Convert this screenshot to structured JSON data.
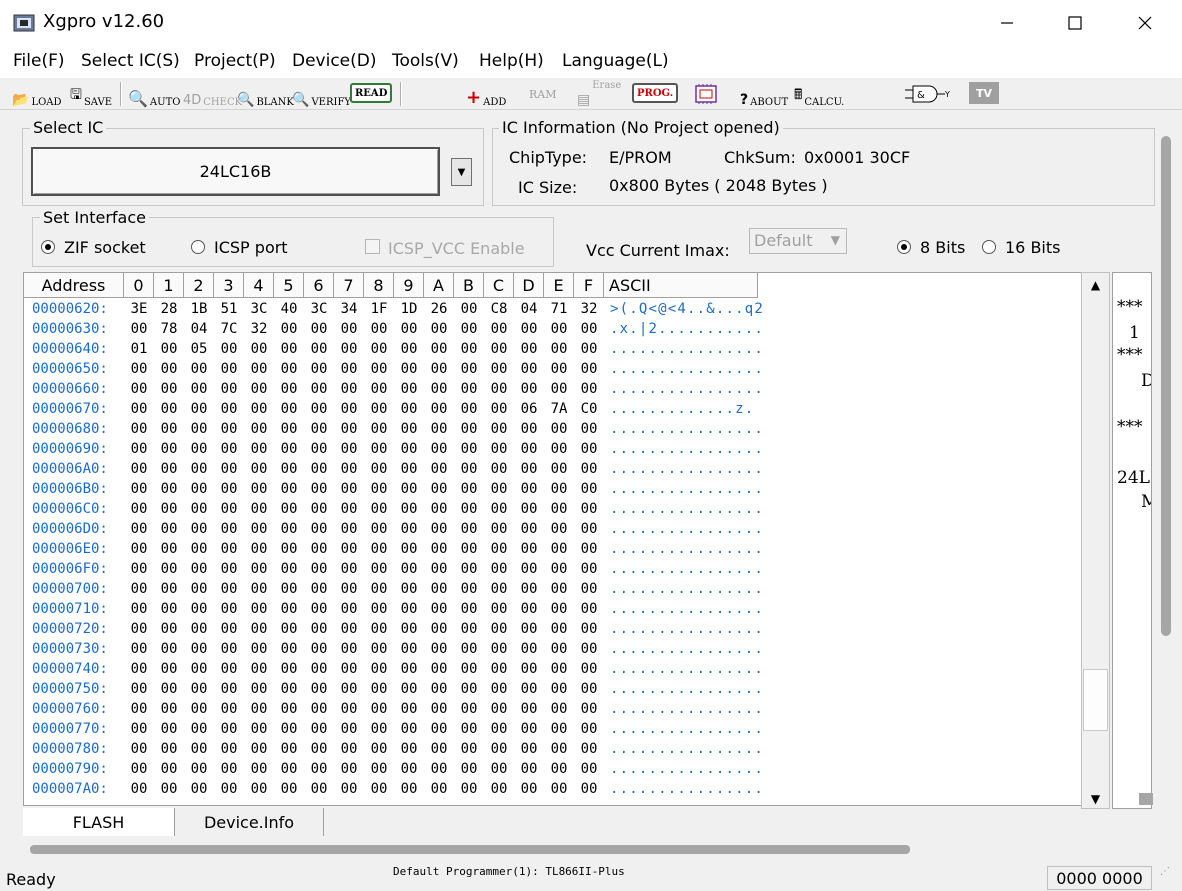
{
  "window": {
    "title": "Xgpro v12.60",
    "min_icon": "minimize-icon",
    "max_icon": "maximize-icon",
    "close_icon": "close-icon"
  },
  "menu": [
    "File(F)",
    "Select IC(S)",
    "Project(P)",
    "Device(D)",
    "Tools(V)",
    "Help(H)",
    "Language(L)"
  ],
  "toolbar": {
    "load": "LOAD",
    "save": "SAVE",
    "auto": "AUTO",
    "check": "CHECK",
    "blank": "BLANK",
    "verify": "VERIFY",
    "read": "READ",
    "add": "ADD",
    "ram": "RAM",
    "erase": "Erase",
    "prog": "PROG.",
    "about": "ABOUT",
    "calcu": "CALCU.",
    "logic": "&",
    "tv": "TV"
  },
  "select_ic": {
    "label": "Select IC",
    "value": "24LC16B"
  },
  "ic_info": {
    "label": "IC Information (No Project opened)",
    "chiptype_label": "ChipType:",
    "chiptype_value": "E/PROM",
    "chksum_label": "ChkSum:",
    "chksum_value": "0x0001 30CF",
    "size_label": "IC Size:",
    "size_value": "0x800 Bytes ( 2048 Bytes )"
  },
  "interface": {
    "label": "Set Interface",
    "zif": "ZIF socket",
    "icsp": "ICSP port",
    "icsp_vcc": "ICSP_VCC Enable",
    "vcc_label": "Vcc Current Imax:",
    "vcc_value": "Default",
    "bits8": "8 Bits",
    "bits16": "16 Bits"
  },
  "hex": {
    "headers": [
      "Address",
      "0",
      "1",
      "2",
      "3",
      "4",
      "5",
      "6",
      "7",
      "8",
      "9",
      "A",
      "B",
      "C",
      "D",
      "E",
      "F",
      "ASCII"
    ],
    "rows": [
      {
        "addr": "00000620:",
        "bytes": [
          "3E",
          "28",
          "1B",
          "51",
          "3C",
          "40",
          "3C",
          "34",
          "1F",
          "1D",
          "26",
          "00",
          "C8",
          "04",
          "71",
          "32"
        ],
        "ascii": ">(.Q<@<4..&...q2"
      },
      {
        "addr": "00000630:",
        "bytes": [
          "00",
          "78",
          "04",
          "7C",
          "32",
          "00",
          "00",
          "00",
          "00",
          "00",
          "00",
          "00",
          "00",
          "00",
          "00",
          "00"
        ],
        "ascii": ".x.|2..........."
      },
      {
        "addr": "00000640:",
        "bytes": [
          "01",
          "00",
          "05",
          "00",
          "00",
          "00",
          "00",
          "00",
          "00",
          "00",
          "00",
          "00",
          "00",
          "00",
          "00",
          "00"
        ],
        "ascii": "................"
      },
      {
        "addr": "00000650:",
        "bytes": [
          "00",
          "00",
          "00",
          "00",
          "00",
          "00",
          "00",
          "00",
          "00",
          "00",
          "00",
          "00",
          "00",
          "00",
          "00",
          "00"
        ],
        "ascii": "................"
      },
      {
        "addr": "00000660:",
        "bytes": [
          "00",
          "00",
          "00",
          "00",
          "00",
          "00",
          "00",
          "00",
          "00",
          "00",
          "00",
          "00",
          "00",
          "00",
          "00",
          "00"
        ],
        "ascii": "................"
      },
      {
        "addr": "00000670:",
        "bytes": [
          "00",
          "00",
          "00",
          "00",
          "00",
          "00",
          "00",
          "00",
          "00",
          "00",
          "00",
          "00",
          "00",
          "06",
          "7A",
          "C0"
        ],
        "ascii": ".............z."
      },
      {
        "addr": "00000680:",
        "bytes": [
          "00",
          "00",
          "00",
          "00",
          "00",
          "00",
          "00",
          "00",
          "00",
          "00",
          "00",
          "00",
          "00",
          "00",
          "00",
          "00"
        ],
        "ascii": "................"
      },
      {
        "addr": "00000690:",
        "bytes": [
          "00",
          "00",
          "00",
          "00",
          "00",
          "00",
          "00",
          "00",
          "00",
          "00",
          "00",
          "00",
          "00",
          "00",
          "00",
          "00"
        ],
        "ascii": "................"
      },
      {
        "addr": "000006A0:",
        "bytes": [
          "00",
          "00",
          "00",
          "00",
          "00",
          "00",
          "00",
          "00",
          "00",
          "00",
          "00",
          "00",
          "00",
          "00",
          "00",
          "00"
        ],
        "ascii": "................"
      },
      {
        "addr": "000006B0:",
        "bytes": [
          "00",
          "00",
          "00",
          "00",
          "00",
          "00",
          "00",
          "00",
          "00",
          "00",
          "00",
          "00",
          "00",
          "00",
          "00",
          "00"
        ],
        "ascii": "................"
      },
      {
        "addr": "000006C0:",
        "bytes": [
          "00",
          "00",
          "00",
          "00",
          "00",
          "00",
          "00",
          "00",
          "00",
          "00",
          "00",
          "00",
          "00",
          "00",
          "00",
          "00"
        ],
        "ascii": "................"
      },
      {
        "addr": "000006D0:",
        "bytes": [
          "00",
          "00",
          "00",
          "00",
          "00",
          "00",
          "00",
          "00",
          "00",
          "00",
          "00",
          "00",
          "00",
          "00",
          "00",
          "00"
        ],
        "ascii": "................"
      },
      {
        "addr": "000006E0:",
        "bytes": [
          "00",
          "00",
          "00",
          "00",
          "00",
          "00",
          "00",
          "00",
          "00",
          "00",
          "00",
          "00",
          "00",
          "00",
          "00",
          "00"
        ],
        "ascii": "................"
      },
      {
        "addr": "000006F0:",
        "bytes": [
          "00",
          "00",
          "00",
          "00",
          "00",
          "00",
          "00",
          "00",
          "00",
          "00",
          "00",
          "00",
          "00",
          "00",
          "00",
          "00"
        ],
        "ascii": "................"
      },
      {
        "addr": "00000700:",
        "bytes": [
          "00",
          "00",
          "00",
          "00",
          "00",
          "00",
          "00",
          "00",
          "00",
          "00",
          "00",
          "00",
          "00",
          "00",
          "00",
          "00"
        ],
        "ascii": "................"
      },
      {
        "addr": "00000710:",
        "bytes": [
          "00",
          "00",
          "00",
          "00",
          "00",
          "00",
          "00",
          "00",
          "00",
          "00",
          "00",
          "00",
          "00",
          "00",
          "00",
          "00"
        ],
        "ascii": "................"
      },
      {
        "addr": "00000720:",
        "bytes": [
          "00",
          "00",
          "00",
          "00",
          "00",
          "00",
          "00",
          "00",
          "00",
          "00",
          "00",
          "00",
          "00",
          "00",
          "00",
          "00"
        ],
        "ascii": "................"
      },
      {
        "addr": "00000730:",
        "bytes": [
          "00",
          "00",
          "00",
          "00",
          "00",
          "00",
          "00",
          "00",
          "00",
          "00",
          "00",
          "00",
          "00",
          "00",
          "00",
          "00"
        ],
        "ascii": "................"
      },
      {
        "addr": "00000740:",
        "bytes": [
          "00",
          "00",
          "00",
          "00",
          "00",
          "00",
          "00",
          "00",
          "00",
          "00",
          "00",
          "00",
          "00",
          "00",
          "00",
          "00"
        ],
        "ascii": "................"
      },
      {
        "addr": "00000750:",
        "bytes": [
          "00",
          "00",
          "00",
          "00",
          "00",
          "00",
          "00",
          "00",
          "00",
          "00",
          "00",
          "00",
          "00",
          "00",
          "00",
          "00"
        ],
        "ascii": "................"
      },
      {
        "addr": "00000760:",
        "bytes": [
          "00",
          "00",
          "00",
          "00",
          "00",
          "00",
          "00",
          "00",
          "00",
          "00",
          "00",
          "00",
          "00",
          "00",
          "00",
          "00"
        ],
        "ascii": "................"
      },
      {
        "addr": "00000770:",
        "bytes": [
          "00",
          "00",
          "00",
          "00",
          "00",
          "00",
          "00",
          "00",
          "00",
          "00",
          "00",
          "00",
          "00",
          "00",
          "00",
          "00"
        ],
        "ascii": "................"
      },
      {
        "addr": "00000780:",
        "bytes": [
          "00",
          "00",
          "00",
          "00",
          "00",
          "00",
          "00",
          "00",
          "00",
          "00",
          "00",
          "00",
          "00",
          "00",
          "00",
          "00"
        ],
        "ascii": "................"
      },
      {
        "addr": "00000790:",
        "bytes": [
          "00",
          "00",
          "00",
          "00",
          "00",
          "00",
          "00",
          "00",
          "00",
          "00",
          "00",
          "00",
          "00",
          "00",
          "00",
          "00"
        ],
        "ascii": "................"
      },
      {
        "addr": "000007A0:",
        "bytes": [
          "00",
          "00",
          "00",
          "00",
          "00",
          "00",
          "00",
          "00",
          "00",
          "00",
          "00",
          "00",
          "00",
          "00",
          "00",
          "00"
        ],
        "ascii": "................"
      }
    ]
  },
  "side_panel": [
    "***",
    "1",
    "***",
    "D",
    "***",
    "24L",
    "M"
  ],
  "tabs": [
    "FLASH",
    "Device.Info"
  ],
  "status": {
    "left": "Ready",
    "middle": "Default Programmer(1): TL866II-Plus",
    "right": "0000 0000"
  },
  "colors": {
    "address": "#1a6bc8",
    "ascii": "#1a6bc8",
    "prog_red": "#cc0000",
    "read_green": "#2e7d32"
  }
}
